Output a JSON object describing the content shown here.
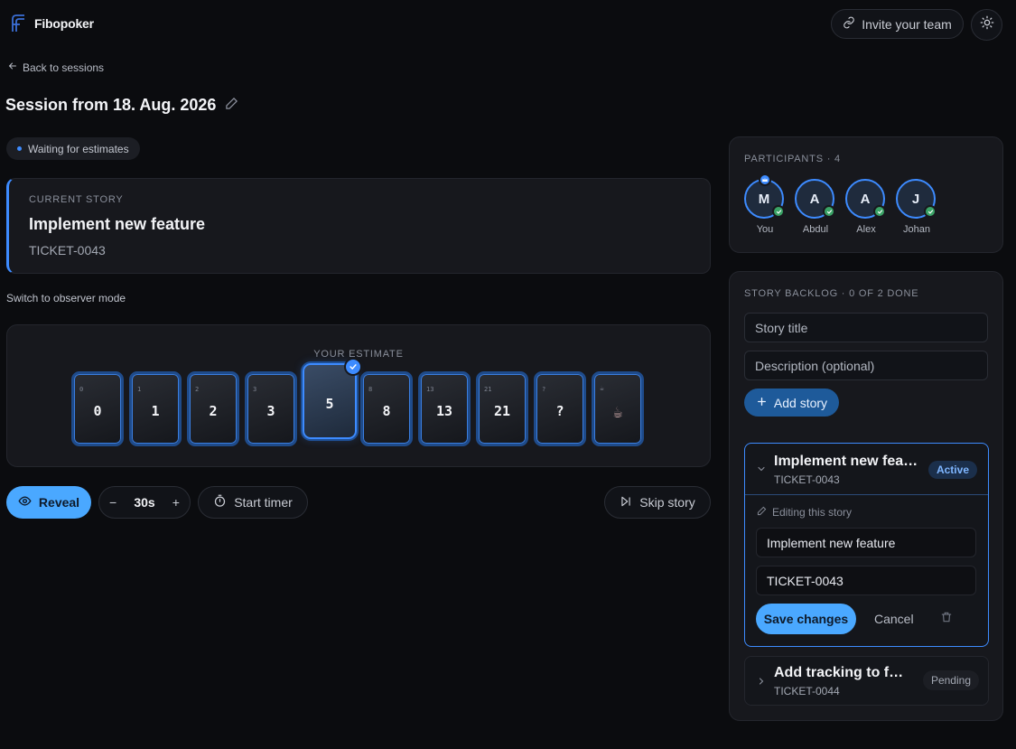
{
  "app": {
    "brand": "Fibopoker",
    "invite_label": "Invite your team"
  },
  "nav": {
    "back_label": "Back to sessions"
  },
  "session": {
    "title": "Session from 18. Aug. 2026",
    "status": "Waiting for estimates"
  },
  "current_story": {
    "label": "CURRENT STORY",
    "title": "Implement new feature",
    "ticket": "TICKET-0043"
  },
  "observer_label": "Switch to observer mode",
  "estimate": {
    "label": "YOUR ESTIMATE",
    "selected": "5",
    "cards": [
      {
        "corner": "0",
        "value": "0"
      },
      {
        "corner": "1",
        "value": "1"
      },
      {
        "corner": "2",
        "value": "2"
      },
      {
        "corner": "3",
        "value": "3"
      },
      {
        "corner": "",
        "value": "5"
      },
      {
        "corner": "8",
        "value": "8"
      },
      {
        "corner": "13",
        "value": "13"
      },
      {
        "corner": "21",
        "value": "21"
      },
      {
        "corner": "?",
        "value": "?"
      },
      {
        "corner": "☕",
        "value": "☕"
      }
    ]
  },
  "controls": {
    "reveal": "Reveal",
    "timer_value": "30s",
    "minus": "−",
    "plus": "+",
    "start_timer": "Start timer",
    "skip_story": "Skip story"
  },
  "participants": {
    "label": "PARTICIPANTS · 4",
    "list": [
      {
        "initial": "M",
        "name": "You",
        "host": true
      },
      {
        "initial": "A",
        "name": "Abdul",
        "host": false
      },
      {
        "initial": "A",
        "name": "Alex",
        "host": false
      },
      {
        "initial": "J",
        "name": "Johan",
        "host": false
      }
    ]
  },
  "backlog": {
    "label": "STORY BACKLOG · 0 OF 2 DONE",
    "title_placeholder": "Story title",
    "description_placeholder": "Description (optional)",
    "add_label": "Add story",
    "active_story": {
      "title": "Implement new feature",
      "ticket": "TICKET-0043",
      "badge": "Active",
      "editing_label": "Editing this story",
      "edit_title_value": "Implement new feature",
      "edit_ticket_value": "TICKET-0043",
      "save_label": "Save changes",
      "cancel_label": "Cancel"
    },
    "pending_story": {
      "title": "Add tracking to feature",
      "ticket": "TICKET-0044",
      "badge": "Pending"
    }
  },
  "colors": {
    "accent": "#3d8bff",
    "button_primary": "#4aa8ff",
    "background": "#0b0c0f",
    "panel": "#17181d",
    "success": "#3aa366"
  }
}
